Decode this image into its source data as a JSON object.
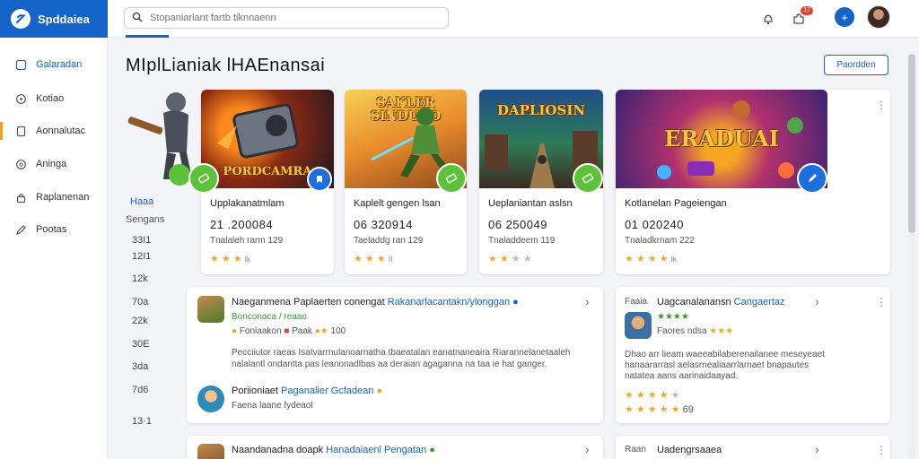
{
  "app": {
    "logo_text": "Spddaiea"
  },
  "search": {
    "placeholder": "Stopaniarlant fartb tiknnaenn"
  },
  "topbar": {
    "notification_badge": "17"
  },
  "sidebar": {
    "items": [
      {
        "label": "Galaradan",
        "icon": "monitor-icon",
        "active": true
      },
      {
        "label": "Kotiao",
        "icon": "location-pin-icon"
      },
      {
        "label": "Aonnalutac",
        "icon": "document-icon"
      },
      {
        "label": "Aninga",
        "icon": "circle-icon"
      },
      {
        "label": "Raplanenan",
        "icon": "lock-icon"
      },
      {
        "label": "Pootas",
        "icon": "pen-icon"
      }
    ]
  },
  "page": {
    "title": "MIplLianiak lHAEnansai",
    "top_button": "Paordden"
  },
  "left_stats": {
    "label_a": "Haaa",
    "label_b": "Sengans",
    "values": [
      "33I1",
      "12I1",
      "12k",
      "70a",
      "22k",
      "30E",
      "3da",
      "7d6",
      "13·1"
    ]
  },
  "game_cards": [
    {
      "image_text": "PORDCAMRA",
      "title": "Upplakanatmlam",
      "number": "21 .200084",
      "sub": "Tnalaleh rarm 129",
      "rating": 3,
      "rating_text": "lk",
      "action_icon": "tag-icon",
      "action_color": "#5cc23a"
    },
    {
      "image_text": "SAKLER SINDUOO",
      "title": "Kaplelt gengen lsan",
      "number": "06 320914",
      "sub": "Taeladdg ran 129",
      "rating": 3,
      "rating_text": "Il",
      "action_icon": "tag-icon",
      "action_color": "#5cc23a"
    },
    {
      "image_text": "DAPLIOSIN",
      "title": "Ueplaniantan aslsn",
      "number": "06 250049",
      "sub": "Tnaladdeem 119",
      "rating": 2,
      "rating_text": "",
      "action_icon": "tag-icon",
      "action_color": "#5cc23a"
    },
    {
      "image_text": "ERADUAI",
      "title": "Kotlanelan Pageiengan",
      "number": "01 020240",
      "sub": "Tnaladkrnam 222",
      "rating": 4,
      "rating_text": "lk",
      "action_icon": "pen-icon",
      "action_color": "#1c6fdc"
    }
  ],
  "reviews": {
    "card1": {
      "title": "Naeganmena Paplaerten conengat",
      "title_link": "Rakanarlacantakn/ylonggan",
      "subtitle": "Bonconaca / reaao",
      "meta": "Fonlaakon",
      "meta2": "Paak",
      "meta_score": "100",
      "body_1": "Pecciiutor raeas Isatvarrnulanoarnatha tbaeatalan eanatnaneaira Riarannelanetaaleh",
      "body_2": "nalalantl ondantta pas leanonadlbas aa deraian agaganna na taa ie hat ganger.",
      "reply_name": "Poriioniaet",
      "reply_link": "Paganalier Gcfadean",
      "reply_text": "Faena laane fydeaol"
    },
    "card2": {
      "label": "Faaia",
      "title": "Uagcanalanansn",
      "title_link": "Cangaertaz",
      "rating_label": "Faores ndsa",
      "body_1": "Dhao arr lieam waeeabilaberenailanee meseyeaet",
      "body_2": "hanaararrasl aelasrnealiaarrlarnaet bnapautes",
      "body_3": "natatea aans aarinaidaayad.",
      "score": "69"
    },
    "card3": {
      "title": "Naandanadna doapk",
      "title_link": "Hanadaiaenl Pengatan"
    },
    "card4": {
      "label": "Raan",
      "title": "Uadengrsaaea"
    }
  },
  "colors": {
    "brand": "#1463c8",
    "accent": "#f0a022",
    "star": "#f0a922",
    "green": "#3a9b2f"
  }
}
